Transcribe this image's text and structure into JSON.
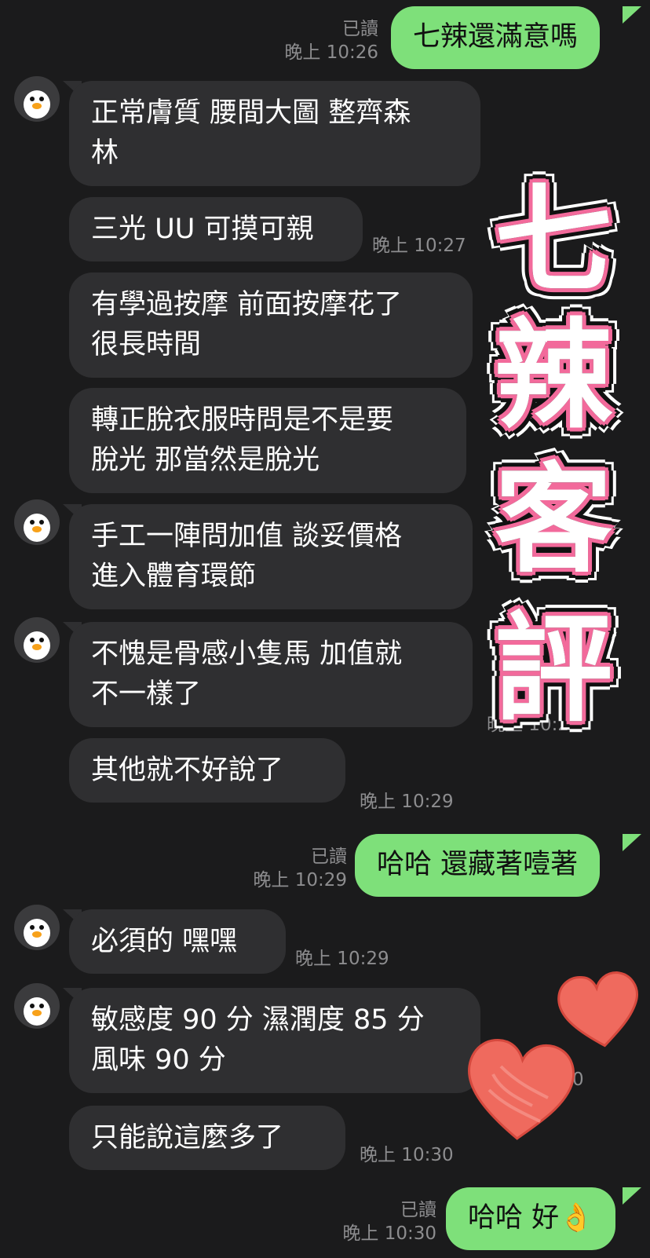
{
  "chat": {
    "messages": [
      {
        "side": "out",
        "text": "七辣還滿意嗎",
        "read": "已讀",
        "time": "晚上 10:26"
      },
      {
        "side": "in",
        "text": "正常膚質 腰間大圖 整齊森\n林",
        "time": "晚上 10:27"
      },
      {
        "side": "in",
        "text": "三光 UU 可摸可親",
        "time": "晚上 10:27"
      },
      {
        "side": "in",
        "text": "有學過按摩 前面按摩花了\n很長時間",
        "time": ""
      },
      {
        "side": "in",
        "text": "轉正脫衣服時問是不是要\n脫光 那當然是脫光",
        "time": ""
      },
      {
        "side": "in",
        "text": "手工一陣問加值 談妥價格\n進入體育環節",
        "time": ""
      },
      {
        "side": "in",
        "text": "不愧是骨感小隻馬 加值就\n不一樣了",
        "time": "晚上 10:29"
      },
      {
        "side": "in",
        "text": "其他就不好說了",
        "time": "晚上 10:29"
      },
      {
        "side": "out",
        "text": "哈哈 還藏著噎著",
        "read": "已讀",
        "time": "晚上 10:29"
      },
      {
        "side": "in",
        "text": "必須的 嘿嘿",
        "time": "晚上 10:29"
      },
      {
        "side": "in",
        "text": "敏感度 90 分 濕潤度 85 分\n風味 90 分",
        "time": "晚上 10:30"
      },
      {
        "side": "in",
        "text": "只能說這麼多了",
        "time": "晚上 10:30"
      },
      {
        "side": "out",
        "text": "哈哈 好👌",
        "read": "已讀",
        "time": "晚上 10:30"
      }
    ]
  },
  "sticker": {
    "chars": [
      "七",
      "辣",
      "客",
      "評"
    ],
    "outline_color": "#f26a9b"
  },
  "avatar_icon": "penguin-icon",
  "colors": {
    "background": "#1b1b1c",
    "incoming_bubble": "#2f2f31",
    "outgoing_bubble": "#7ee07a",
    "heart": "#ef6a5e"
  }
}
